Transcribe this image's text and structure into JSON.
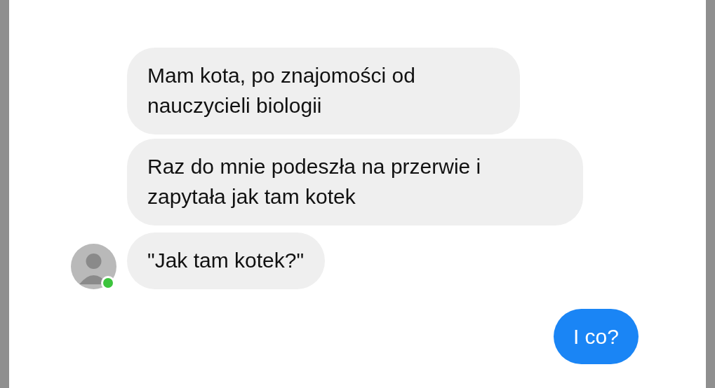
{
  "contact": {
    "online": true
  },
  "messages": [
    {
      "kind": "incoming",
      "text": "Mam kota, po znajomości od nauczycieli biologii"
    },
    {
      "kind": "incoming",
      "text": "Raz do mnie podeszła na przerwie i zapytała jak tam kotek"
    },
    {
      "kind": "incoming",
      "text": "\"Jak tam kotek?\""
    },
    {
      "kind": "outgoing",
      "text": "I co?"
    }
  ]
}
